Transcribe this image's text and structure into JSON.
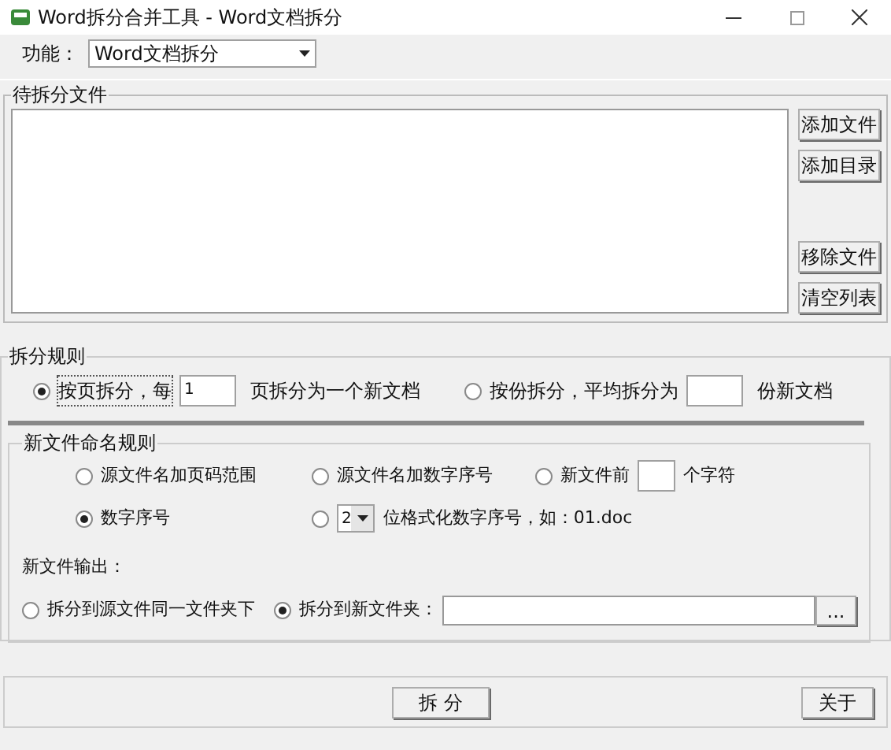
{
  "window": {
    "title": "Word拆分合并工具 - Word文档拆分"
  },
  "function": {
    "label": "功能：",
    "value": "Word文档拆分"
  },
  "files": {
    "title": "待拆分文件",
    "buttons": [
      "添加文件",
      "添加目录",
      "移除文件",
      "清空列表"
    ]
  },
  "split_rules": {
    "title": "拆分规则",
    "options": [
      {
        "label": "按页拆分，每",
        "selected": true,
        "value": "1",
        "suffix": "页拆分为一个新文档"
      },
      {
        "label": "按份拆分，平均拆分为",
        "selected": false,
        "suffix": "份新文档"
      }
    ]
  },
  "naming": {
    "title": "新文件命名规则",
    "options": [
      {
        "kind": "plain",
        "label": "源文件名加页码范围",
        "selected": false
      },
      {
        "kind": "plain",
        "label": "源文件名加数字序号",
        "selected": false
      },
      {
        "kind": "chars",
        "label": "新文件前",
        "selected": false,
        "suffix": "个字符"
      },
      {
        "kind": "plain",
        "label": "数字序号",
        "selected": true
      },
      {
        "kind": "digits",
        "selected": false,
        "value": "2",
        "suffix": "位格式化数字序号，如：01.doc"
      }
    ],
    "output_title": "新文件输出：",
    "output": [
      {
        "label": "拆分到源文件同一文件夹下",
        "selected": false
      },
      {
        "label": "拆分到新文件夹：",
        "selected": true
      }
    ],
    "browse": "..."
  },
  "footer": {
    "buttons": [
      "拆 分",
      "关于"
    ]
  }
}
